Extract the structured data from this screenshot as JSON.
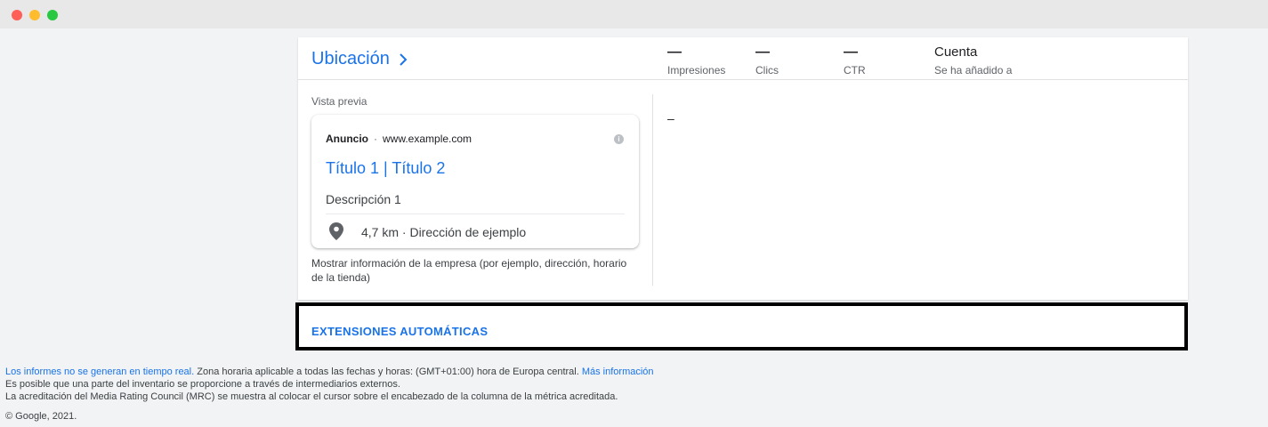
{
  "header": {
    "title": "Ubicación",
    "metrics": [
      {
        "value": "—",
        "label": "Impresiones"
      },
      {
        "value": "—",
        "label": "Clics"
      },
      {
        "value": "—",
        "label": "CTR"
      },
      {
        "value": "Cuenta",
        "label": "Se ha añadido a"
      }
    ]
  },
  "preview": {
    "label": "Vista previa",
    "ad": {
      "badge": "Anuncio",
      "separator": "·",
      "url": "www.example.com",
      "headline": "Título 1 | Título 2",
      "description": "Descripción 1",
      "location": "4,7 km · Dirección de ejemplo"
    },
    "caption": "Mostrar información de la empresa (por ejemplo, dirección, horario de la tienda)"
  },
  "right_value": "–",
  "extensions": {
    "label": "EXTENSIONES AUTOMÁTICAS"
  },
  "footer": {
    "link1": "Los informes no se generan en tiempo real.",
    "line1_text": " Zona horaria aplicable a todas las fechas y horas: (GMT+01:00) hora de Europa central. ",
    "link2": "Más información",
    "line2": "Es posible que una parte del inventario se proporcione a través de intermediarios externos.",
    "line3": "La acreditación del Media Rating Council (MRC) se muestra al colocar el cursor sobre el encabezado de la columna de la métrica acreditada.",
    "copyright": "© Google, 2021."
  },
  "colors": {
    "accent": "#1a73e8",
    "background": "#f1f3f4"
  }
}
